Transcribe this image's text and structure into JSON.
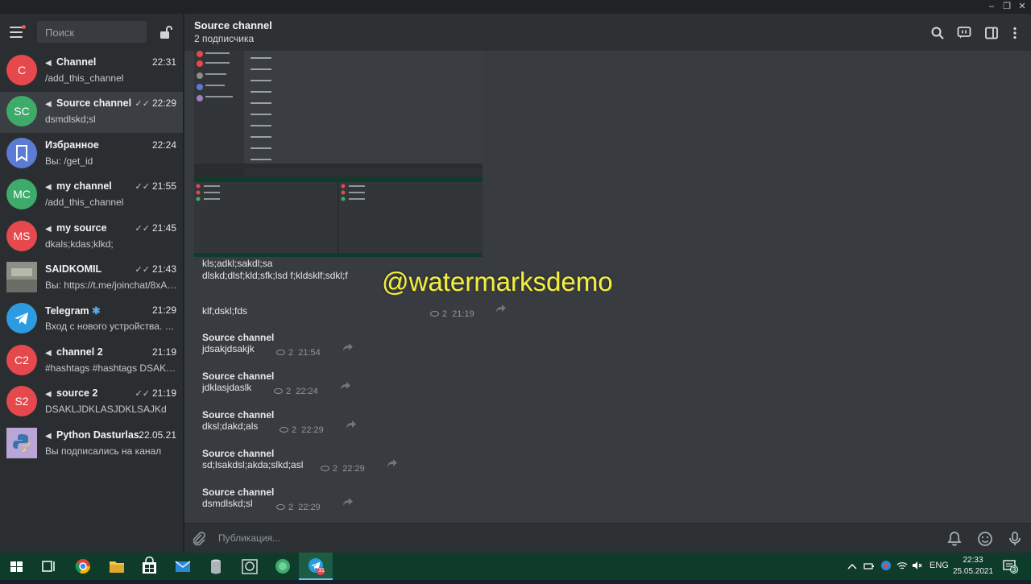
{
  "window": {
    "minimize": "–",
    "restore": "❐",
    "close": "✕"
  },
  "sidebar": {
    "search_placeholder": "Поиск",
    "chats": [
      {
        "avatar": "C",
        "color": "#e5484d",
        "name": "Channel",
        "channel": true,
        "time": "22:31",
        "ticks": "",
        "msg": "/add_this_channel"
      },
      {
        "avatar": "SC",
        "color": "#3fab6b",
        "name": "Source channel",
        "channel": true,
        "time": "22:29",
        "ticks": "✓✓",
        "msg": "dsmdlskd;sl",
        "selected": true
      },
      {
        "avatar": "",
        "color": "#5b7bd5",
        "name": "Избранное",
        "channel": false,
        "time": "22:24",
        "ticks": "",
        "msg": "Вы: /get_id"
      },
      {
        "avatar": "MC",
        "color": "#3fab6b",
        "name": "my channel",
        "channel": true,
        "time": "21:55",
        "ticks": "✓✓",
        "msg": "/add_this_channel"
      },
      {
        "avatar": "MS",
        "color": "#e5484d",
        "name": "my source",
        "channel": true,
        "time": "21:45",
        "ticks": "✓✓",
        "msg": "dkals;kdas;klkd;"
      },
      {
        "avatar": "",
        "color": "#8b8f86",
        "name": "SAIDKOMIL",
        "channel": false,
        "time": "21:43",
        "ticks": "✓✓",
        "msg": "Вы: https://t.me/joinchat/8xA0..."
      },
      {
        "avatar": "",
        "color": "#2d9be0",
        "name": "Telegram",
        "channel": false,
        "verified": true,
        "time": "21:29",
        "ticks": "",
        "msg": "Вход с нового устройства. Bitt..."
      },
      {
        "avatar": "C2",
        "color": "#e5484d",
        "name": "channel 2",
        "channel": true,
        "time": "21:19",
        "ticks": "",
        "msg": "#hashtags #hashtags DSAKLJ..."
      },
      {
        "avatar": "S2",
        "color": "#e5484d",
        "name": "source 2",
        "channel": true,
        "time": "21:19",
        "ticks": "✓✓",
        "msg": "DSAKLJDKLASJDKLSAJKd"
      },
      {
        "avatar": "",
        "color": "#9c7fc0",
        "name": "Python Dasturlas...",
        "channel": true,
        "time": "22.05.21",
        "ticks": "",
        "msg": "Вы подписались на канал"
      }
    ]
  },
  "header": {
    "title": "Source channel",
    "subtitle": "2 подписчика"
  },
  "messages": {
    "photo_caption": "kls;adkl;sakdl;sa dlskd;dlsf;kld;sfk;lsd f;kldsklf;sdkl;f",
    "first_text": "klf;dskl;fds",
    "first_views": "2",
    "first_time": "21:19",
    "posts": [
      {
        "name": "Source channel",
        "text": "jdsakjdsakjk",
        "views": "2",
        "time": "21:54"
      },
      {
        "name": "Source channel",
        "text": "jdklasjdaslk",
        "views": "2",
        "time": "22:24"
      },
      {
        "name": "Source channel",
        "text": "dksl;dakd;als",
        "views": "2",
        "time": "22:29"
      },
      {
        "name": "Source channel",
        "text": "sd;lsakdsl;akda;slkd;asl",
        "views": "2",
        "time": "22:29"
      },
      {
        "name": "Source channel",
        "text": "dsmdlskd;sl",
        "views": "2",
        "time": "22:29"
      }
    ]
  },
  "watermark": "@watermarksdemo",
  "compose": {
    "placeholder": "Публикация..."
  },
  "taskbar": {
    "lang": "ENG",
    "time": "22:33",
    "date": "25.05.2021",
    "notif_count": "3",
    "telegram_badge": "31"
  }
}
